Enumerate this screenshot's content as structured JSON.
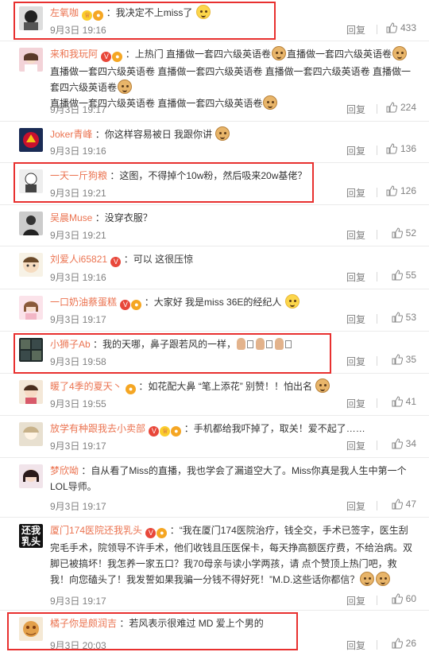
{
  "reply_label": "回复",
  "comments": [
    {
      "user": "左氧咖",
      "text": "：我决定不上miss了",
      "time": "9月3日 19:16",
      "likes": "433"
    },
    {
      "user": "来和我玩阿",
      "text": "：上热门 直播做一套四六级英语卷",
      "extra1": "直播做一套四六级英语卷",
      "extra2": "直播做一套四六级英语卷 直播做一套四六级英语卷 直播做一套四六级英语卷 直播做一套四六级英语卷",
      "extra3": "直播做一套四六级英语卷 直播做一套四六级英语卷",
      "time": "9月3日 19:17",
      "likes": "224"
    },
    {
      "user": "Joker青峰",
      "text": "：你这样容易被日 我跟你讲",
      "time": "9月3日 19:16",
      "likes": "136"
    },
    {
      "user": "一天一斤狗粮",
      "text": "：这图，不得掉个10w粉，然后吸来20w基佬？",
      "time": "9月3日 19:21",
      "likes": "126"
    },
    {
      "user": "吴晨Muse",
      "text": "：没穿衣服？",
      "time": "9月3日 19:21",
      "likes": "52"
    },
    {
      "user": "刘爱人i65821",
      "text": "：可以 这很压惊",
      "time": "9月3日 19:16",
      "likes": "55"
    },
    {
      "user": "一口奶油蔡蛋糕",
      "text": "：大家好 我是miss 36E的经纪人",
      "time": "9月3日 19:17",
      "likes": "53"
    },
    {
      "user": "小狮子Ab",
      "text": "：我的天哪，鼻子跟若风的一样，",
      "time": "9月3日 19:58",
      "likes": "35"
    },
    {
      "user": "暖了4季的夏天丶",
      "text": "：如花配大鼻 “笔上添花” 别赞！！怕出名",
      "time": "9月3日 19:55",
      "likes": "41"
    },
    {
      "user": "放学有种跟我去小卖部",
      "text": "：手机都给我吓掉了，取关！爱不起了……",
      "time": "9月3日 19:17",
      "likes": "34"
    },
    {
      "user": "梦欣呦",
      "text": "：自从看了Miss的直播，我也学会了漏道空大了。Miss你真是我人生中第一个",
      "text2": "LOL导师。",
      "time": "9月3日 19:17",
      "likes": "47"
    },
    {
      "user": "厦门174医院还我乳头",
      "text": "：“我在厦门174医院治疗，钱全交，手术已签字，医生刮",
      "text2": "完毛手术，院领导不许手术，他们收钱且压医保卡，每天挣高额医疗费，不给治病。双",
      "text3": "脚已被搞坏！我怎养一家五口？我70母亲与读小学两孩，请 点个赞顶上热门吧，救",
      "text4": "我！向您磕头了！我发誓如果我骗一分钱不得好死！”M.D.这些话你都信？",
      "avatar_text": "还我乳头",
      "time": "9月3日 19:17",
      "likes": "60"
    },
    {
      "user": "橘子你是颇润吉",
      "text": "：若风表示很难过 MD 爱上个男的",
      "time": "9月3日 20:03",
      "likes": "26"
    }
  ]
}
